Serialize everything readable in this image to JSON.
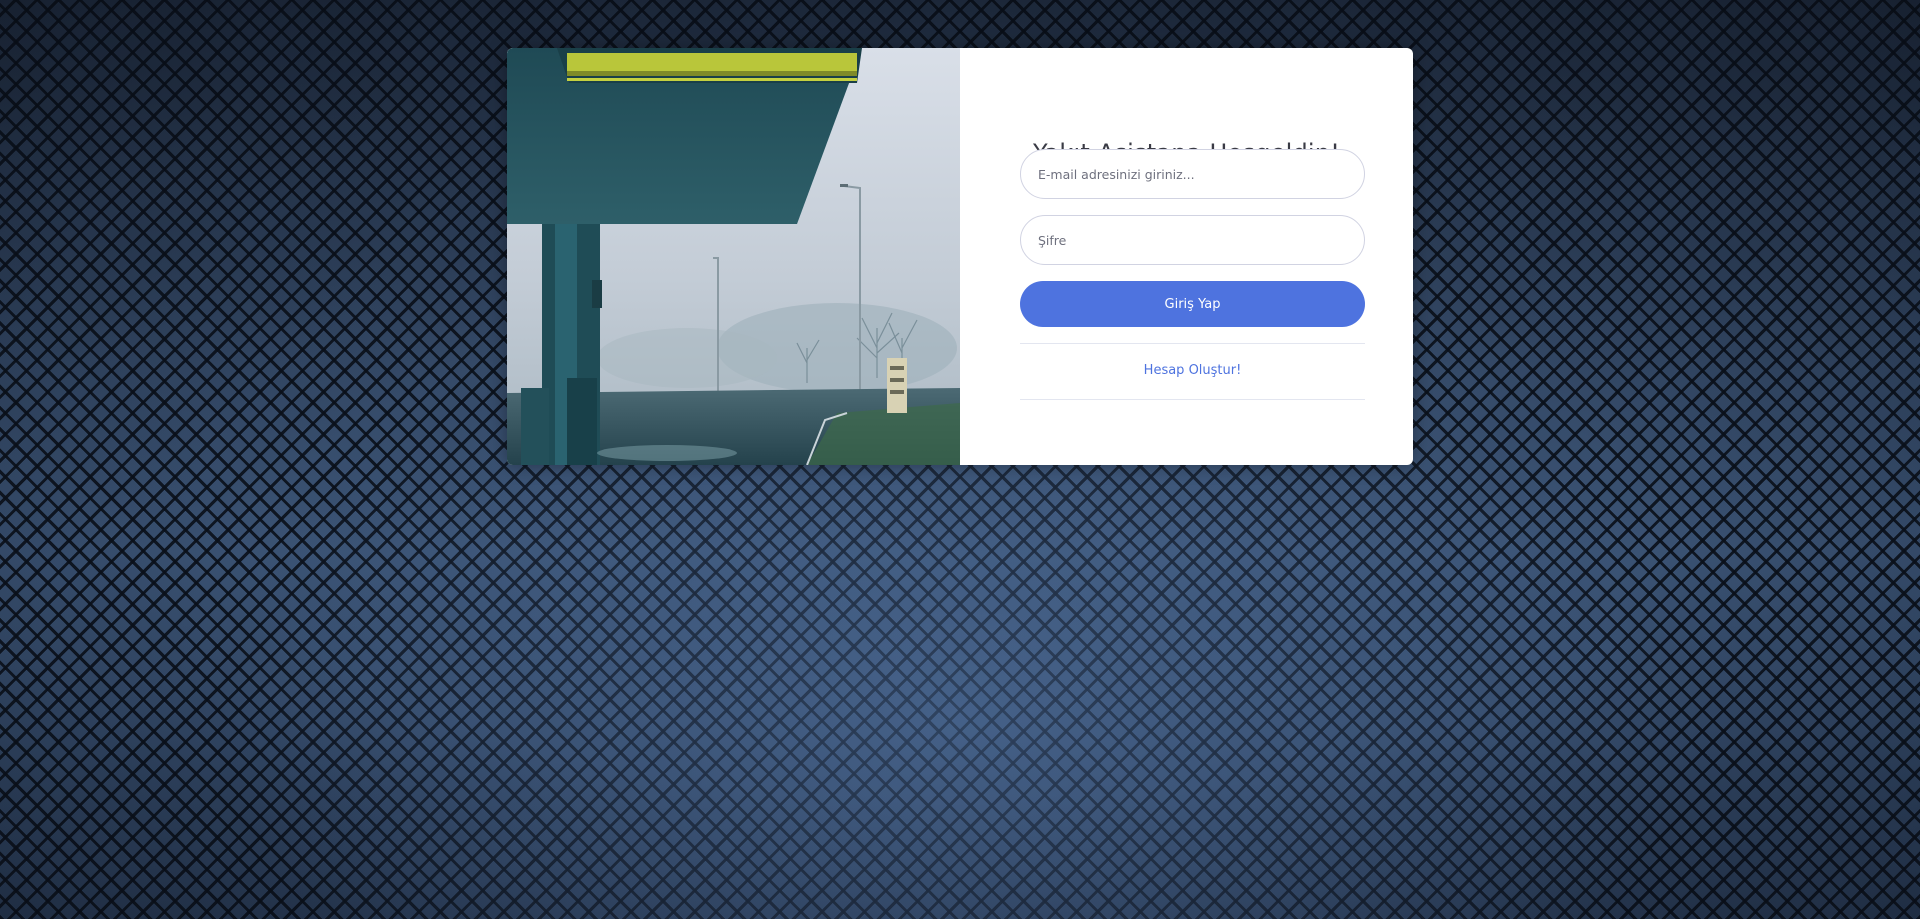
{
  "login": {
    "title": "Yakıt Asistana Hoşgeldin!",
    "email_placeholder": "E-mail adresinizi giriniz...",
    "password_placeholder": "Şifre",
    "login_button": "Giriş Yap",
    "signup_link": "Hesap Oluştur!"
  },
  "colors": {
    "primary": "#4e73df",
    "card_background": "#ffffff",
    "title_text": "#3a3b45"
  },
  "icons": []
}
